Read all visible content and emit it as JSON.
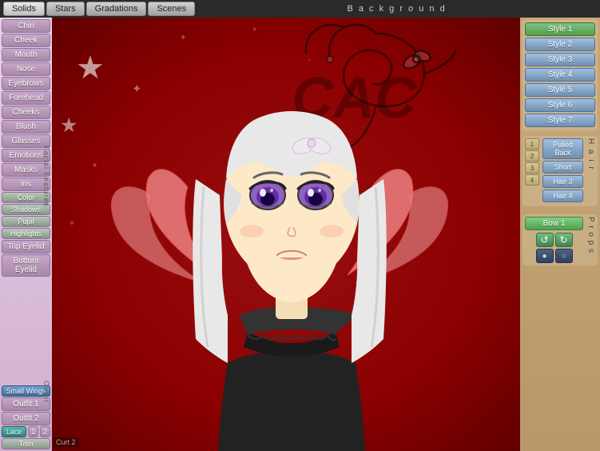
{
  "topbar": {
    "tabs": [
      "Solids",
      "Stars",
      "Gradations",
      "Scenes"
    ],
    "background_label": "B a c k g r o u n d"
  },
  "left_sidebar": {
    "buttons": [
      {
        "label": "Chin",
        "id": "chin"
      },
      {
        "label": "Cheek",
        "id": "cheek"
      },
      {
        "label": "Mouth",
        "id": "mouth"
      },
      {
        "label": "Nose",
        "id": "nose"
      },
      {
        "label": "Eyebrows",
        "id": "eyebrows"
      },
      {
        "label": "Forehead",
        "id": "forehead"
      },
      {
        "label": "Cheeks",
        "id": "cheeks"
      },
      {
        "label": "Blush",
        "id": "blush"
      },
      {
        "label": "Glasses",
        "id": "glasses"
      },
      {
        "label": "Emotions",
        "id": "emotions"
      },
      {
        "label": "Masks",
        "id": "masks"
      },
      {
        "label": "Iris",
        "id": "iris"
      },
      {
        "label": "Color",
        "id": "color",
        "type": "color"
      },
      {
        "label": "Shadows",
        "id": "shadows",
        "type": "color"
      },
      {
        "label": "Pupil",
        "id": "pupil",
        "type": "color"
      },
      {
        "label": "Highlights",
        "id": "highlights",
        "type": "color"
      },
      {
        "label": "Top Eyelid",
        "id": "top-eyelid"
      },
      {
        "label": "Bottom Eyelid",
        "id": "bottom-eyelid"
      }
    ],
    "facial_features_label": "F a c i a l   F e a t u r e s",
    "outfit_buttons": [
      {
        "label": "Small Wings",
        "id": "small-wings",
        "type": "blue"
      },
      {
        "label": "Outfit 1",
        "id": "outfit1"
      },
      {
        "label": "Outfit 2",
        "id": "outfit2"
      }
    ],
    "outfit_label": "O u t f i t",
    "lace_label": "Lace",
    "trim_label": "Trim",
    "num_1": "1",
    "num_2": "2"
  },
  "right_sidebar": {
    "style_buttons": [
      "Style 1",
      "Style 2",
      "Style 3",
      "Style 4",
      "Style 5",
      "Style 6",
      "Style 7"
    ],
    "hair_nums": [
      "1",
      "2",
      "3",
      "4"
    ],
    "hair_buttons": [
      "Pulled Back",
      "Short",
      "Hair 3",
      "Hair 4"
    ],
    "hair_label": "H a i r",
    "props_label": "P r o p s",
    "bow_label": "Bow 1"
  },
  "colors": {
    "bg_dark_red": "#8B0000",
    "sidebar_purple": "#c8a8c8",
    "sidebar_right": "#c8a878"
  }
}
